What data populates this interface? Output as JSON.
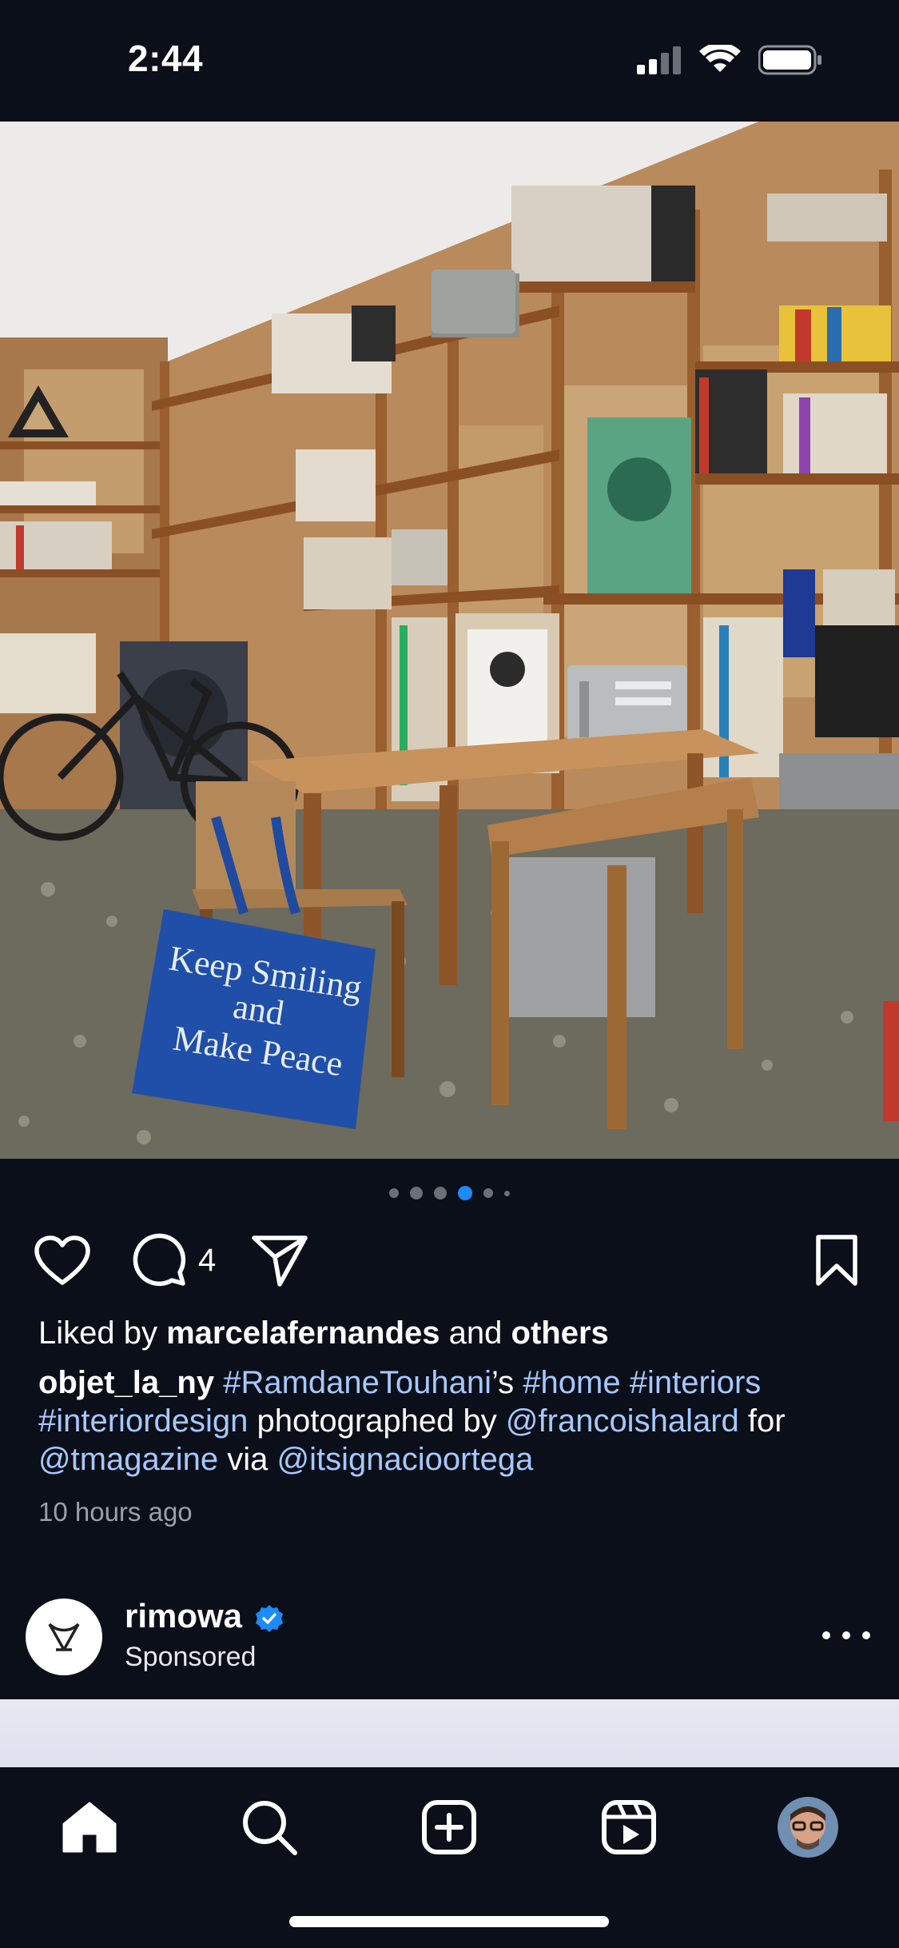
{
  "status_bar": {
    "time": "2:44"
  },
  "post": {
    "carousel": {
      "total": 6,
      "active_index": 3
    },
    "comment_count": "4",
    "likes": {
      "prefix": "Liked by",
      "user": "marcelafernandes",
      "joiner": "and",
      "others": "others"
    },
    "caption": {
      "username": "objet_la_ny",
      "tag1": "#RamdaneTouhani",
      "tag1_suffix": "’s",
      "tag2": "#home",
      "tag3": "#interiors",
      "tag4": "#interiordesign",
      "text1": "photographed by",
      "mention1": "@francoishalard",
      "text2": "for",
      "mention2": "@tmagazine",
      "text3": "via",
      "mention3": "@itsignacioortega"
    },
    "timestamp": "10 hours ago",
    "image_text": {
      "bag_line1": "Keep Smiling",
      "bag_line2": "and",
      "bag_line3": "Make Peace"
    }
  },
  "sponsored_post": {
    "username": "rimowa",
    "label": "Sponsored"
  },
  "nav": {
    "items": [
      "home-icon",
      "search-icon",
      "create-icon",
      "reels-icon",
      "profile-avatar"
    ]
  },
  "colors": {
    "background": "#0b0f19",
    "link": "#a6c8ff",
    "active_dot": "#1a8cff",
    "verified": "#1a8cff"
  }
}
